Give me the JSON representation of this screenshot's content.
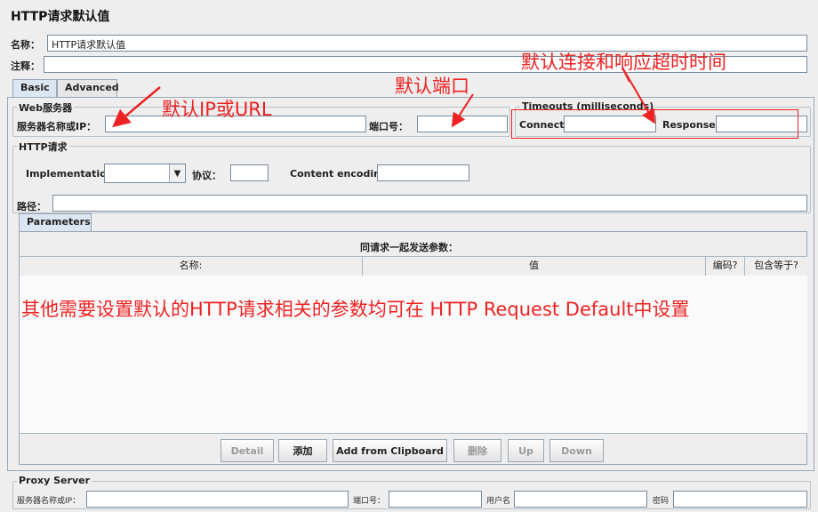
{
  "title": "HTTP请求默认值",
  "name": {
    "label": "名称：",
    "value": "HTTP请求默认值"
  },
  "comment": {
    "label": "注释：",
    "value": ""
  },
  "tabs": [
    {
      "label": "Basic",
      "active": true
    },
    {
      "label": "Advanced",
      "active": false
    }
  ],
  "web_server": {
    "legend": "Web服务器",
    "server_label": "服务器名称或IP：",
    "port_label": "端口号："
  },
  "timeouts": {
    "legend": "Timeouts (milliseconds)",
    "connect_label": "Connect:",
    "response_label": "Response:"
  },
  "http_request": {
    "legend": "HTTP请求",
    "implementation_label": "Implementation:",
    "implementation_value": "",
    "protocol_label": "协议：",
    "encoding_label": "Content encoding:",
    "path_label": "路径："
  },
  "parameters": {
    "tab_label": "Parameters",
    "caption": "同请求一起发送参数：",
    "columns": [
      "名称:",
      "值",
      "编码?",
      "包含等于?"
    ]
  },
  "buttons": {
    "detail": "Detail",
    "add": "添加",
    "add_clipboard": "Add from Clipboard",
    "delete": "删除",
    "up": "Up",
    "down": "Down"
  },
  "proxy": {
    "legend": "Proxy Server",
    "server_label": "服务器名称或IP：",
    "port_label": "端口号：",
    "user_label": "用户名",
    "password_label": "密码"
  },
  "annotations": {
    "default_ip": "默认IP或URL",
    "default_port": "默认端口",
    "default_timeout": "默认连接和响应超时时间",
    "other_params": "其他需要设置默认的HTTP请求相关的参数均可在 HTTP Request Default中设置"
  },
  "colors": {
    "annotation": "#ee2222",
    "panel_border": "#9aa7b3",
    "tab_active": "#dbe6f2"
  }
}
